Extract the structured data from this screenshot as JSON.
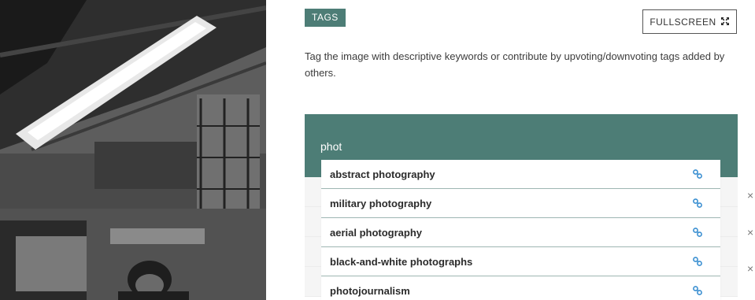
{
  "tags": {
    "badge": "TAGS",
    "fullscreen_label": "FULLSCREEN",
    "fullscreen_icon": "expand-arrows-icon",
    "description": "Tag the image with descriptive keywords or contribute by upvoting/downvoting tags added by others."
  },
  "input": {
    "value": "phot"
  },
  "suggestions": [
    {
      "label": "abstract photography",
      "icon": "link-icon"
    },
    {
      "label": "military photography",
      "icon": "link-icon"
    },
    {
      "label": "aerial photography",
      "icon": "link-icon"
    },
    {
      "label": "black-and-white photographs",
      "icon": "link-icon"
    },
    {
      "label": "photojournalism",
      "icon": "link-icon"
    }
  ],
  "remove_marks": [
    "×",
    "×",
    "×"
  ],
  "colors": {
    "accent": "#4d7d76",
    "link_icon": "#3a8fd1"
  }
}
